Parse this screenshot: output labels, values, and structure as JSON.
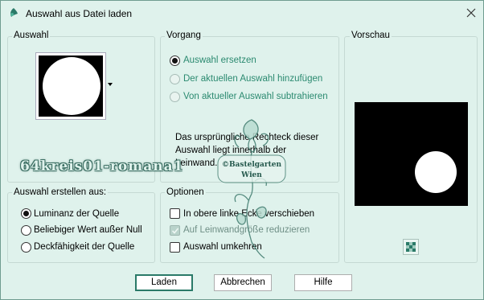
{
  "window": {
    "title": "Auswahl aus Datei laden"
  },
  "groups": {
    "auswahl": "Auswahl",
    "vorgang": "Vorgang",
    "vorschau": "Vorschau",
    "erstellen": "Auswahl erstellen aus:",
    "optionen": "Optionen"
  },
  "vorgang": {
    "options": [
      {
        "label": "Auswahl ersetzen",
        "selected": true,
        "enabled": true
      },
      {
        "label": "Der aktuellen Auswahl hinzufügen",
        "selected": false,
        "enabled": false
      },
      {
        "label": "Von aktueller Auswahl subtrahieren",
        "selected": false,
        "enabled": false
      }
    ],
    "info_line1": "Das ursprüngliche Rechteck dieser",
    "info_line2": "Auswahl liegt innerhalb der",
    "info_line3": "Leinwand."
  },
  "erstellen": {
    "options": [
      {
        "label": "Luminanz der Quelle",
        "selected": true
      },
      {
        "label": "Beliebiger Wert außer Null",
        "selected": false
      },
      {
        "label": "Deckfähigkeit der Quelle",
        "selected": false
      }
    ]
  },
  "optionen": {
    "items": [
      {
        "label": "In obere linke Ecke verschieben",
        "checked": false,
        "enabled": true
      },
      {
        "label": "Auf Leinwandgröße reduzieren",
        "checked": true,
        "enabled": false
      },
      {
        "label": "Auswahl umkehren",
        "checked": false,
        "enabled": true
      }
    ]
  },
  "buttons": {
    "load": "Laden",
    "cancel": "Abbrechen",
    "help": "Hilfe"
  },
  "watermark": {
    "text": "64kreis01-romana1"
  },
  "stamp": {
    "line1": "©Bastelgarten",
    "line2": "Wien"
  },
  "colors": {
    "background": "#dff2ec",
    "accent": "#2a7a68",
    "green_text": "#2b8a70"
  }
}
